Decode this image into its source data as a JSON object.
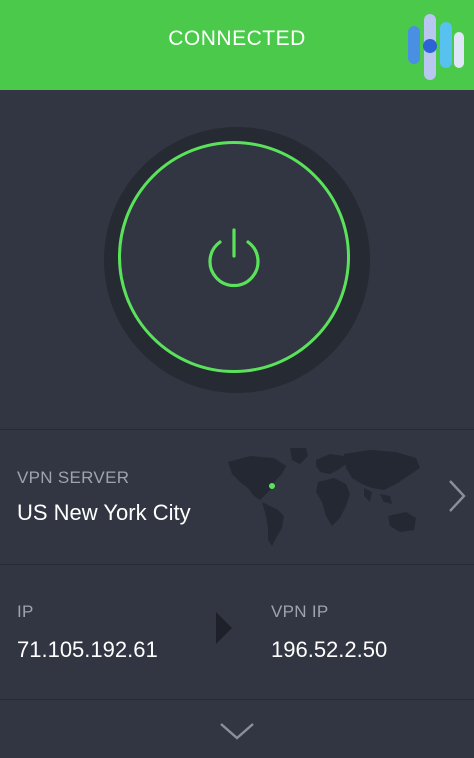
{
  "header": {
    "status_text": "CONNECTED",
    "bg_color": "#4bc94b"
  },
  "brand": {
    "logo_icon": "security-org-logo"
  },
  "power": {
    "icon": "power-icon",
    "ring_color": "#5ae35a"
  },
  "server": {
    "label": "VPN SERVER",
    "location": "US New York City",
    "map_icon": "world-map",
    "chevron_icon": "chevron-right-icon"
  },
  "ip": {
    "local_label": "IP",
    "local_value": "71.105.192.61",
    "arrow_icon": "arrow-right-icon",
    "vpn_label": "VPN IP",
    "vpn_value": "196.52.2.50"
  },
  "footer": {
    "expand_icon": "chevron-down-icon"
  }
}
